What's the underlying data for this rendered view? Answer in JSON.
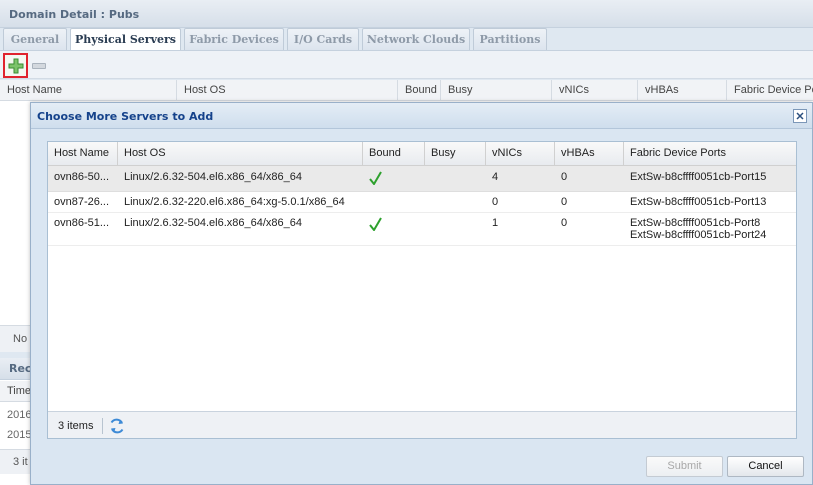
{
  "panel": {
    "title": "Domain Detail : Pubs"
  },
  "tabs": [
    {
      "label": "General"
    },
    {
      "label": "Physical Servers",
      "active": true
    },
    {
      "label": "Fabric Devices"
    },
    {
      "label": "I/O Cards"
    },
    {
      "label": "Network Clouds"
    },
    {
      "label": "Partitions"
    }
  ],
  "toolbar": {
    "add_icon": "plus-icon",
    "remove_icon": "minus-icon"
  },
  "background_grid": {
    "columns": [
      "Host Name",
      "Host OS",
      "Bound",
      "Busy",
      "vNICs",
      "vHBAs",
      "Fabric Device Po"
    ],
    "status_text": "No"
  },
  "background_panel2": {
    "title": "Rec",
    "column": "Time",
    "rows": [
      "2016",
      "2015"
    ],
    "status_text": "3 it"
  },
  "dialog": {
    "title": "Choose More Servers to Add",
    "grid": {
      "columns": [
        "Host Name",
        "Host OS",
        "Bound",
        "Busy",
        "vNICs",
        "vHBAs",
        "Fabric Device Ports"
      ],
      "rows": [
        {
          "host_name": "ovn86-50...",
          "host_os": "Linux/2.6.32-504.el6.x86_64/x86_64",
          "bound": true,
          "busy": "",
          "vnics": "4",
          "vhbas": "0",
          "ports": [
            "ExtSw-b8cffff0051cb-Port15"
          ]
        },
        {
          "host_name": "ovn87-26...",
          "host_os": "Linux/2.6.32-220.el6.x86_64:xg-5.0.1/x86_64",
          "bound": false,
          "busy": "",
          "vnics": "0",
          "vhbas": "0",
          "ports": [
            "ExtSw-b8cffff0051cb-Port13"
          ]
        },
        {
          "host_name": "ovn86-51...",
          "host_os": "Linux/2.6.32-504.el6.x86_64/x86_64",
          "bound": true,
          "busy": "",
          "vnics": "1",
          "vhbas": "0",
          "ports": [
            "ExtSw-b8cffff0051cb-Port8",
            "ExtSw-b8cffff0051cb-Port24"
          ]
        }
      ],
      "item_count": "3 items"
    },
    "buttons": {
      "submit": "Submit",
      "cancel": "Cancel"
    }
  },
  "colors": {
    "title_text": "#15428b",
    "check_green": "#2ea12e",
    "highlight_red": "#e0232e",
    "add_green": "#3fa33f"
  }
}
